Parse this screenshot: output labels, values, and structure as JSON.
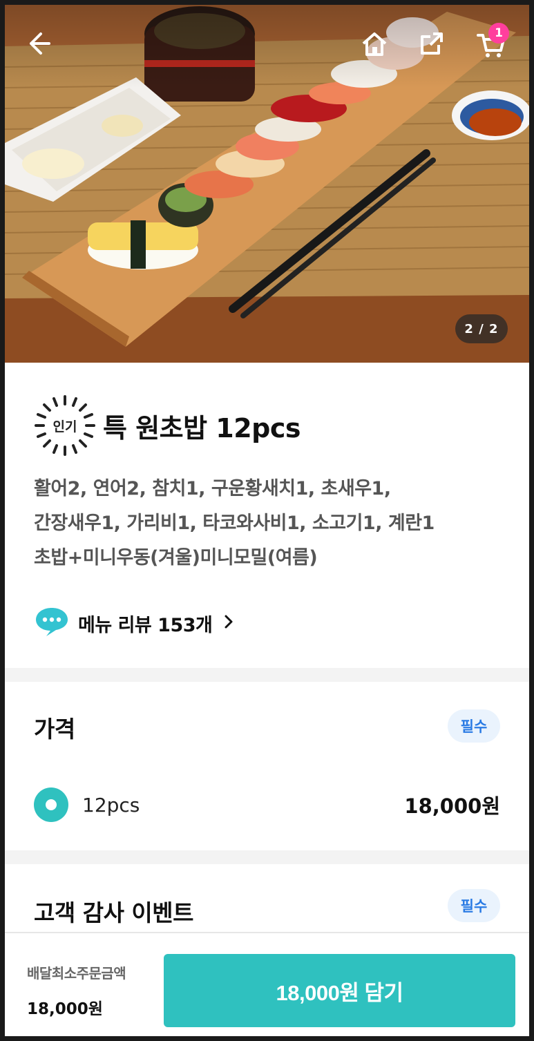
{
  "header": {
    "cart_count": "1",
    "page_indicator": "2 / 2"
  },
  "product": {
    "badge": "인기",
    "title": "특 원초밥 12pcs",
    "description": [
      "활어2, 연어2, 참치1, 구운황새치1, 초새우1,",
      "간장새우1, 가리비1, 타코와사비1, 소고기1, 계란1",
      "초밥+미니우동(겨울)미니모밀(여름)"
    ],
    "review_label": "메뉴 리뷰 153개"
  },
  "price_section": {
    "title": "가격",
    "required_label": "필수",
    "option": {
      "name": "12pcs",
      "price": "18,000원"
    }
  },
  "event_section": {
    "title": "고객 감사 이벤트",
    "required_label": "필수"
  },
  "bottom_bar": {
    "min_order_label": "배달최소주문금액",
    "min_order_value": "18,000원",
    "add_button_label": "18,000원 담기"
  },
  "colors": {
    "accent": "#2fc1bf",
    "badge_pink": "#ff3f9d",
    "required_blue": "#2a7be4"
  },
  "icons": [
    "back-arrow-icon",
    "home-icon",
    "share-icon",
    "cart-icon",
    "speech-bubble-icon",
    "chevron-right-icon",
    "radio-selected-icon"
  ]
}
